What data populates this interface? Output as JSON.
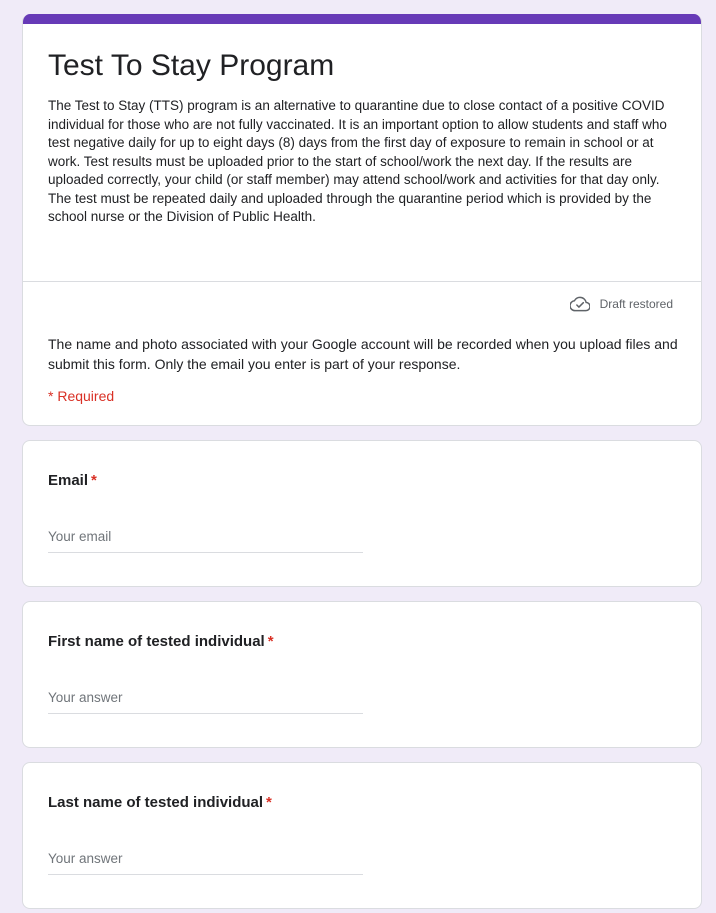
{
  "form": {
    "title": "Test To Stay Program",
    "description": "The Test to Stay (TTS) program is an alternative to quarantine due to close contact of a positive COVID individual for those who are not fully vaccinated. It is an important option to allow students and staff who test negative daily for up to eight days  (8) days from the first day of exposure to remain in school or at work.  Test results must be uploaded prior to the start of school/work the next day.  If the results are uploaded correctly, your child (or staff member) may attend school/work and activities for that day only.  The test must be repeated daily and uploaded through the quarantine period which is provided by the school nurse or the Division of Public Health.",
    "draft_status": "Draft restored",
    "account_note": "The name and photo associated with your Google account will be recorded when you upload files and submit this form. Only the email you enter is part of your response.",
    "required_note": "* Required"
  },
  "questions": [
    {
      "label": "Email",
      "required_mark": "*",
      "placeholder": "Your email",
      "value": ""
    },
    {
      "label": "First name of tested individual",
      "required_mark": "*",
      "placeholder": "Your answer",
      "value": ""
    },
    {
      "label": "Last name of tested individual",
      "required_mark": "*",
      "placeholder": "Your answer",
      "value": ""
    }
  ],
  "icons": {
    "draft": "cloud-done-icon"
  },
  "colors": {
    "background": "#f0ebf8",
    "accent": "#673ab7",
    "required": "#d93025",
    "border": "#dadce0",
    "muted_text": "#5f6368"
  }
}
